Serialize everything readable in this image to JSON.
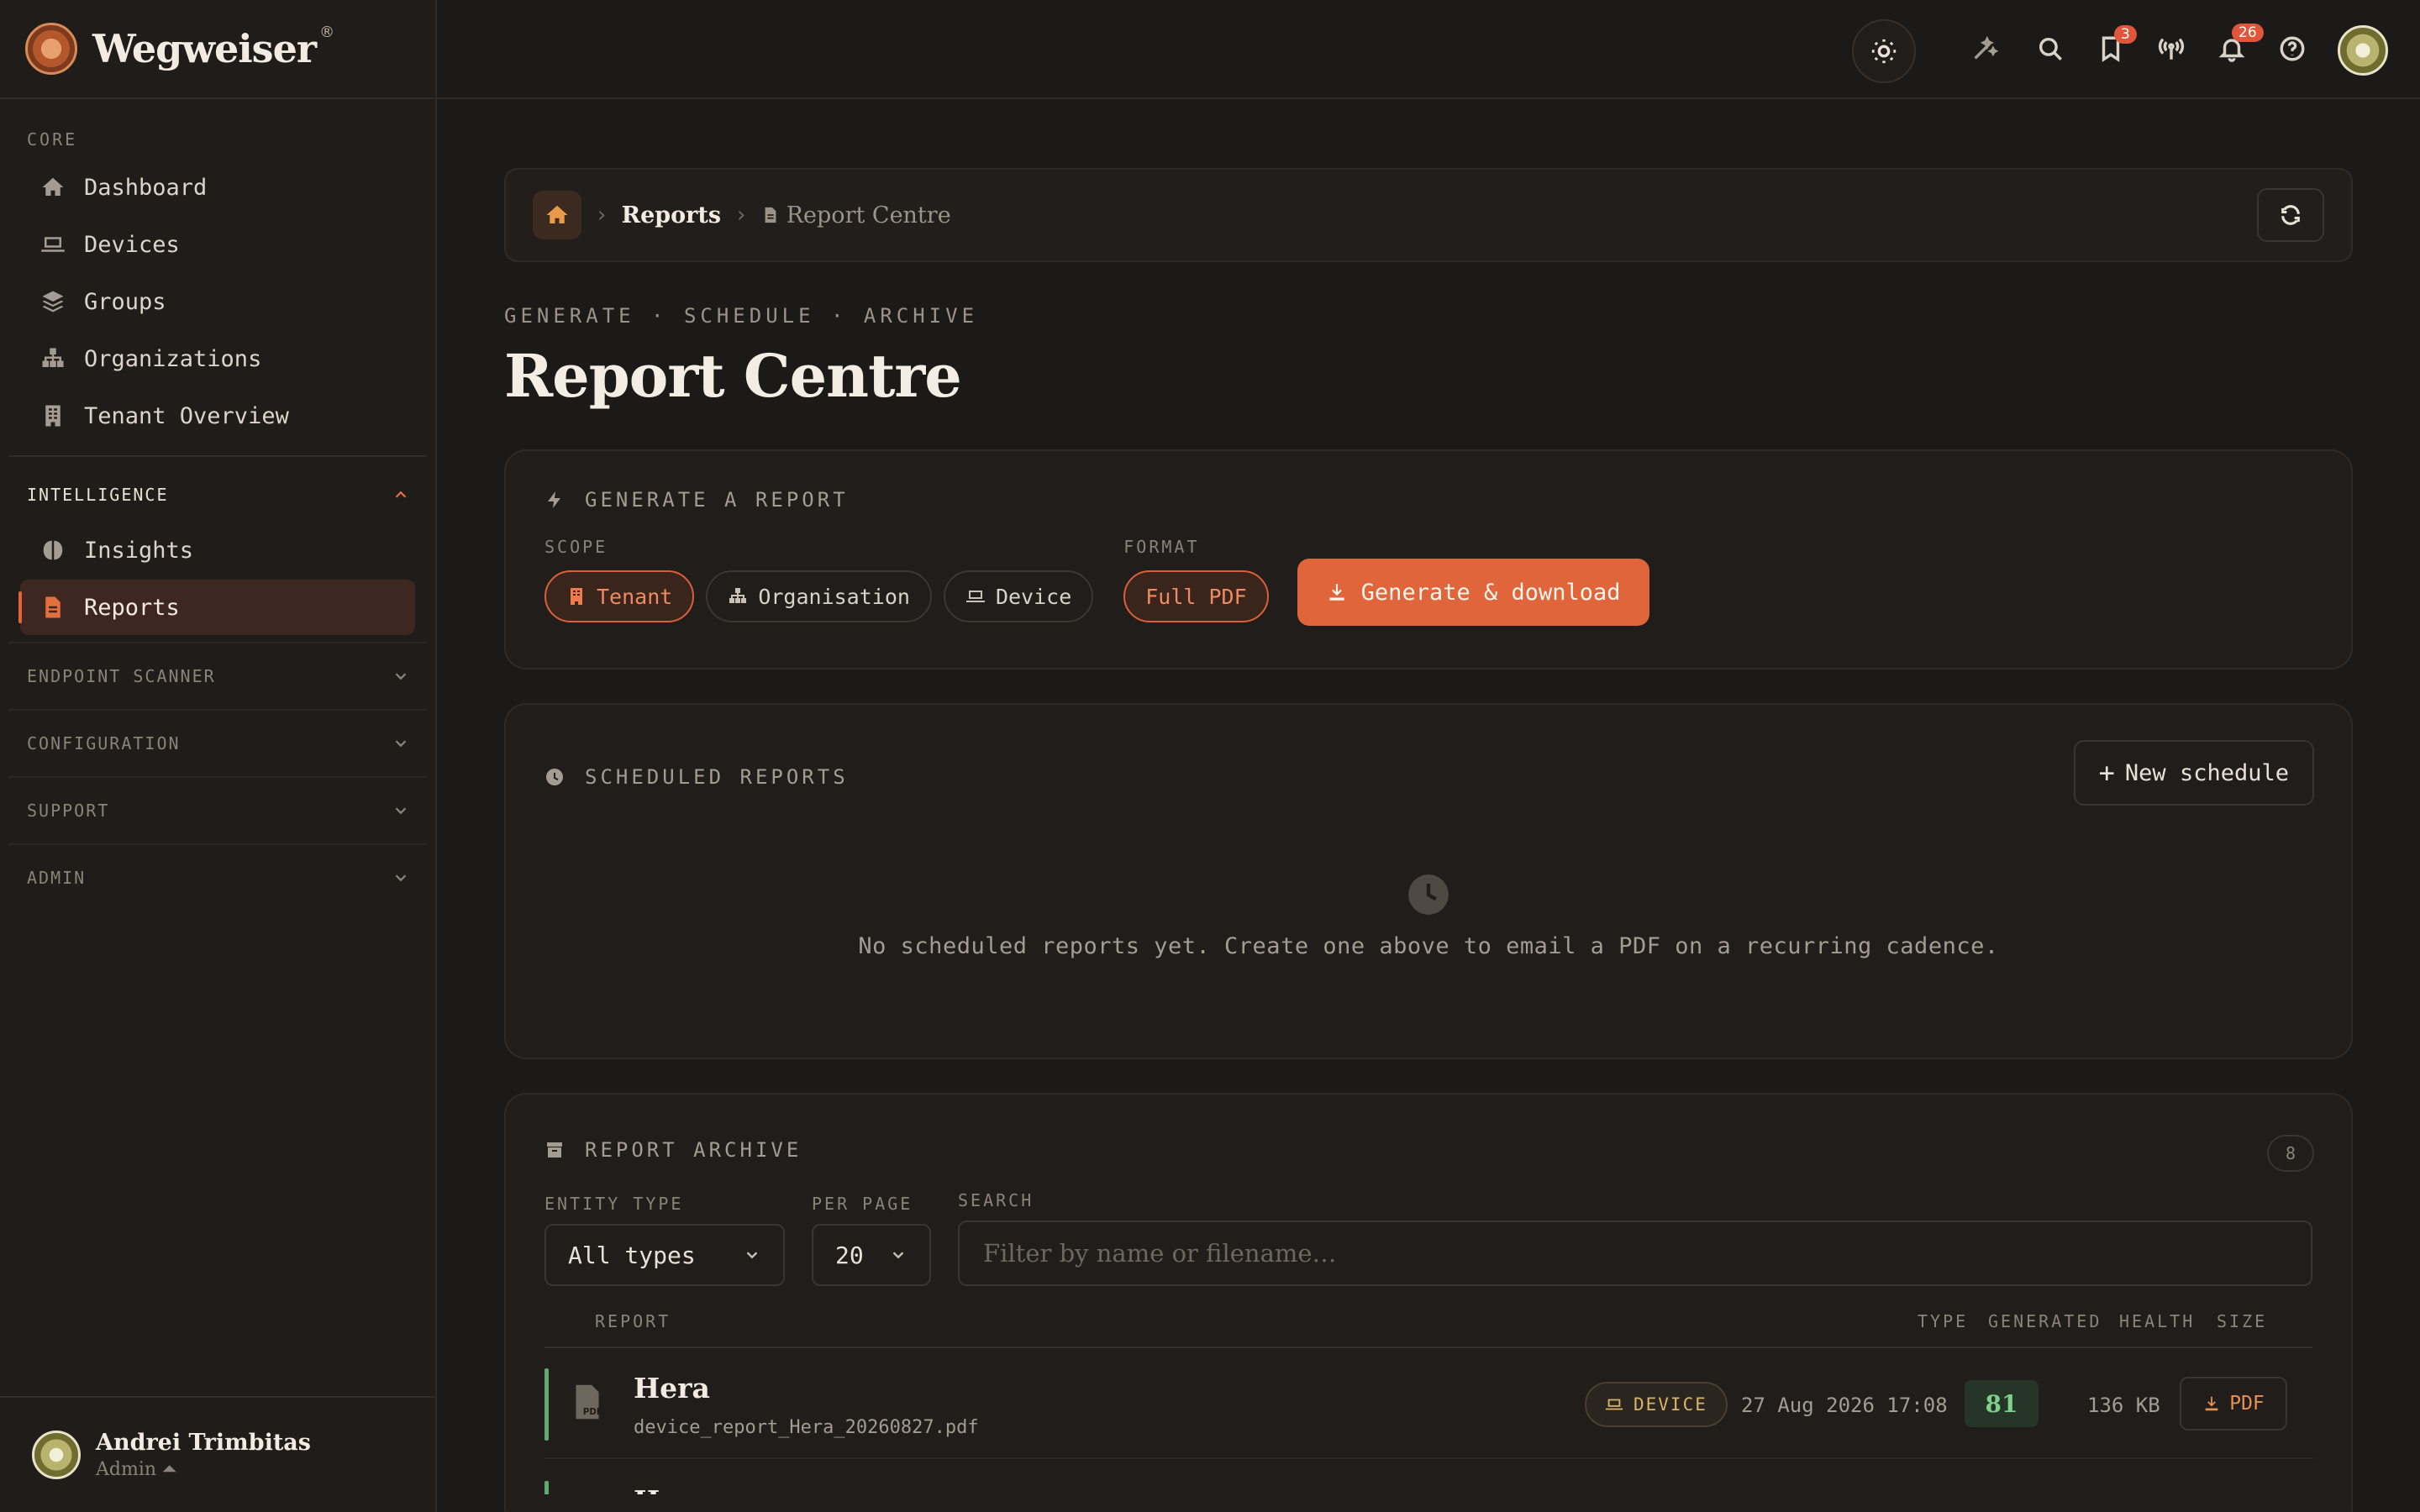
{
  "brand": {
    "name": "Wegweiser",
    "reg": "®"
  },
  "sidebar": {
    "core_label": "CORE",
    "core_items": [
      {
        "label": "Dashboard",
        "icon": "home-icon"
      },
      {
        "label": "Devices",
        "icon": "laptop-icon"
      },
      {
        "label": "Groups",
        "icon": "layers-icon"
      },
      {
        "label": "Organizations",
        "icon": "sitemap-icon"
      },
      {
        "label": "Tenant Overview",
        "icon": "building-icon"
      }
    ],
    "intelligence_label": "INTELLIGENCE",
    "intelligence_items": [
      {
        "label": "Insights",
        "icon": "brain-icon"
      },
      {
        "label": "Reports",
        "icon": "file-icon",
        "active": true
      }
    ],
    "collapsed_groups": [
      "ENDPOINT SCANNER",
      "CONFIGURATION",
      "SUPPORT",
      "ADMIN"
    ],
    "user": {
      "name": "Andrei Trimbitas",
      "role": "Admin ⏶"
    }
  },
  "topbar": {
    "bookmark_badge": "3",
    "notification_badge": "26"
  },
  "breadcrumb": {
    "parent": "Reports",
    "current": "Report Centre"
  },
  "page": {
    "eyebrow": "GENERATE · SCHEDULE · ARCHIVE",
    "title": "Report Centre"
  },
  "generate": {
    "title": "GENERATE A REPORT",
    "scope_label": "SCOPE",
    "scopes": [
      "Tenant",
      "Organisation",
      "Device"
    ],
    "selected_scope": "Tenant",
    "format_label": "FORMAT",
    "format": "Full PDF",
    "button": "Generate & download"
  },
  "scheduled": {
    "title": "SCHEDULED REPORTS",
    "new_button": "New schedule",
    "empty_text": "No scheduled reports yet. Create one above to email a PDF on a recurring cadence."
  },
  "archive": {
    "title": "REPORT ARCHIVE",
    "count": "8",
    "entity_type_label": "ENTITY TYPE",
    "entity_type_value": "All types",
    "per_page_label": "PER PAGE",
    "per_page_value": "20",
    "search_label": "SEARCH",
    "search_placeholder": "Filter by name or filename…",
    "columns": [
      "REPORT",
      "TYPE",
      "GENERATED",
      "HEALTH",
      "SIZE"
    ],
    "rows": [
      {
        "name": "Hera",
        "file": "device_report_Hera_20260827.pdf",
        "type": "DEVICE",
        "generated": "27 Aug 2026 17:08",
        "health": "81",
        "size": "136 KB",
        "action": "PDF"
      },
      {
        "name": "Hera"
      }
    ]
  },
  "colors": {
    "accent": "#e0653a",
    "health_good": "#7fd08a",
    "background": "#1c1a18"
  }
}
